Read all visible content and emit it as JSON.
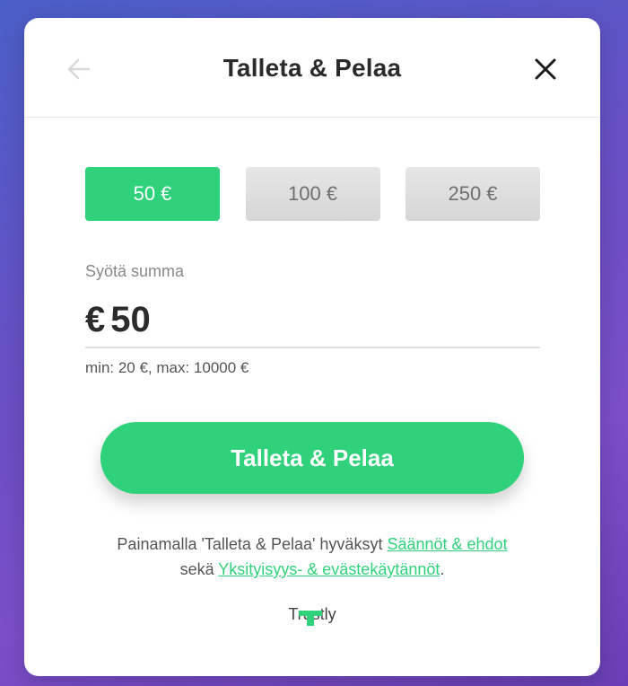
{
  "header": {
    "title": "Talleta & Pelaa",
    "back_icon": "arrow-left-icon",
    "close_icon": "close-icon"
  },
  "amount_options": [
    {
      "label": "50 €",
      "selected": true
    },
    {
      "label": "100 €",
      "selected": false
    },
    {
      "label": "250 €",
      "selected": false
    }
  ],
  "input": {
    "label": "Syötä summa",
    "currency": "€",
    "value": "50",
    "limits": "min: 20 €, max: 10000 €"
  },
  "submit": {
    "label": "Talleta & Pelaa"
  },
  "terms": {
    "prefix": "Painamalla 'Talleta & Pelaa' hyväksyt ",
    "link1": "Säännöt & ehdot",
    "middle": "sekä ",
    "link2": "Yksityisyys- & evästekäytännöt",
    "suffix": "."
  },
  "provider": {
    "name": "Trustly"
  },
  "colors": {
    "accent": "#2fd27a",
    "text": "#2b2b2b",
    "muted": "#888888",
    "background_start": "#4a5fc7",
    "background_end": "#6a3fb5"
  }
}
